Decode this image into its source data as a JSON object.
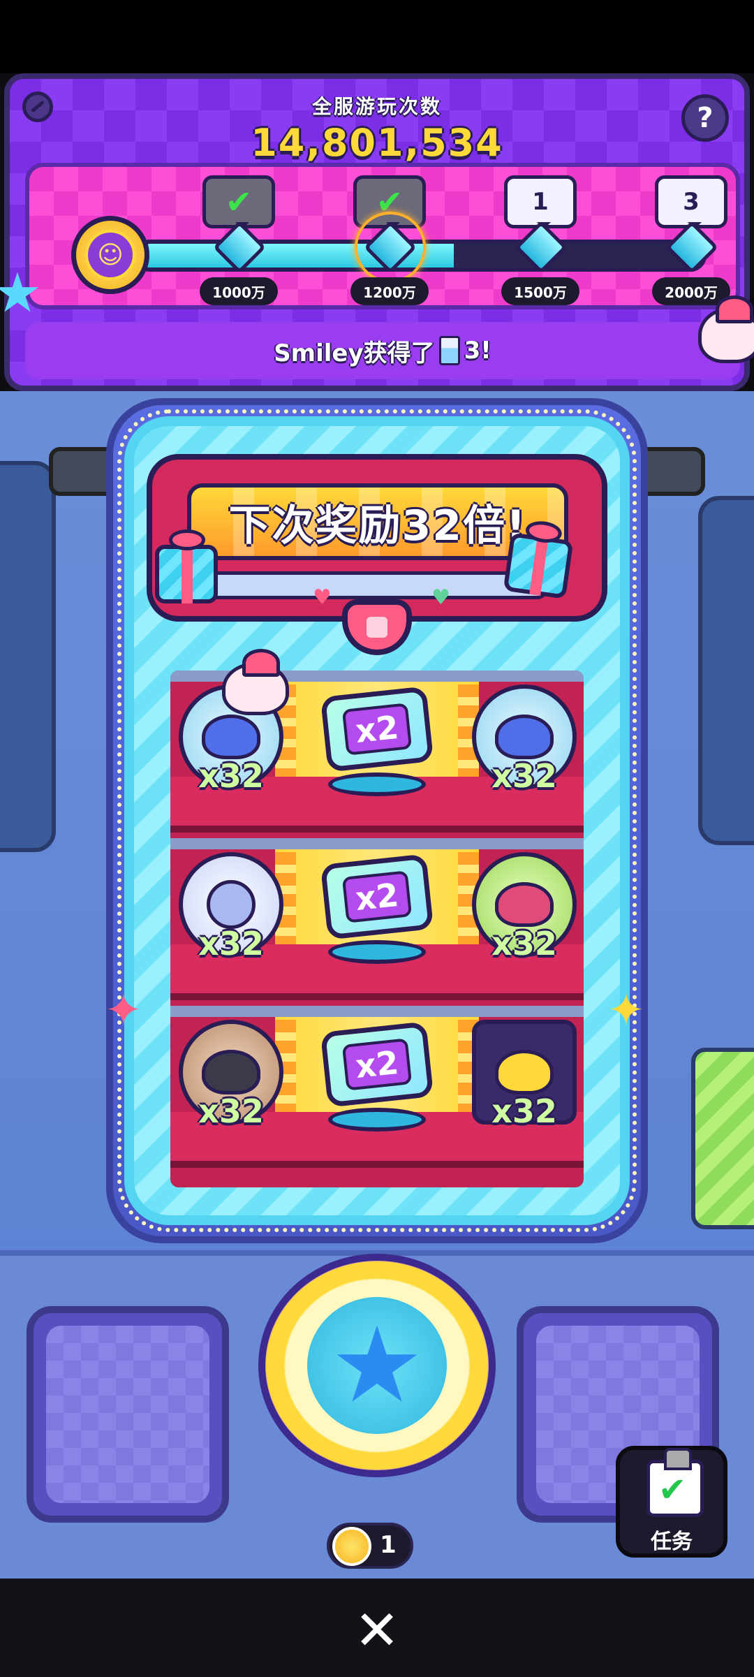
{
  "header": {
    "title": "全服游玩次数",
    "count": "14,801,534",
    "help_label": "?",
    "milestones": [
      {
        "label": "1000万",
        "status": "claimed",
        "badge": "✔"
      },
      {
        "label": "1200万",
        "status": "claimed",
        "badge": "✔"
      },
      {
        "label": "1500万",
        "status": "locked",
        "badge": "1"
      },
      {
        "label": "2000万",
        "status": "locked",
        "badge": "3"
      }
    ],
    "progress_fraction": 0.56
  },
  "announcement": {
    "player": "Smiley获得了",
    "suffix": "3!"
  },
  "banner": {
    "text": "下次奖励32倍!"
  },
  "rows": [
    {
      "left_mult": "x32",
      "center": "x2",
      "right_mult": "x32"
    },
    {
      "left_mult": "x32",
      "center": "x2",
      "right_mult": "x32"
    },
    {
      "left_mult": "x32",
      "center": "x2",
      "right_mult": "x32"
    }
  ],
  "controls": {
    "coin_count": "1",
    "task_label": "任务",
    "close_label": "✕"
  },
  "colors": {
    "accent_purple": "#8a3cf2",
    "gold": "#ffd93a",
    "ticket_pink": "#d22a5c"
  }
}
